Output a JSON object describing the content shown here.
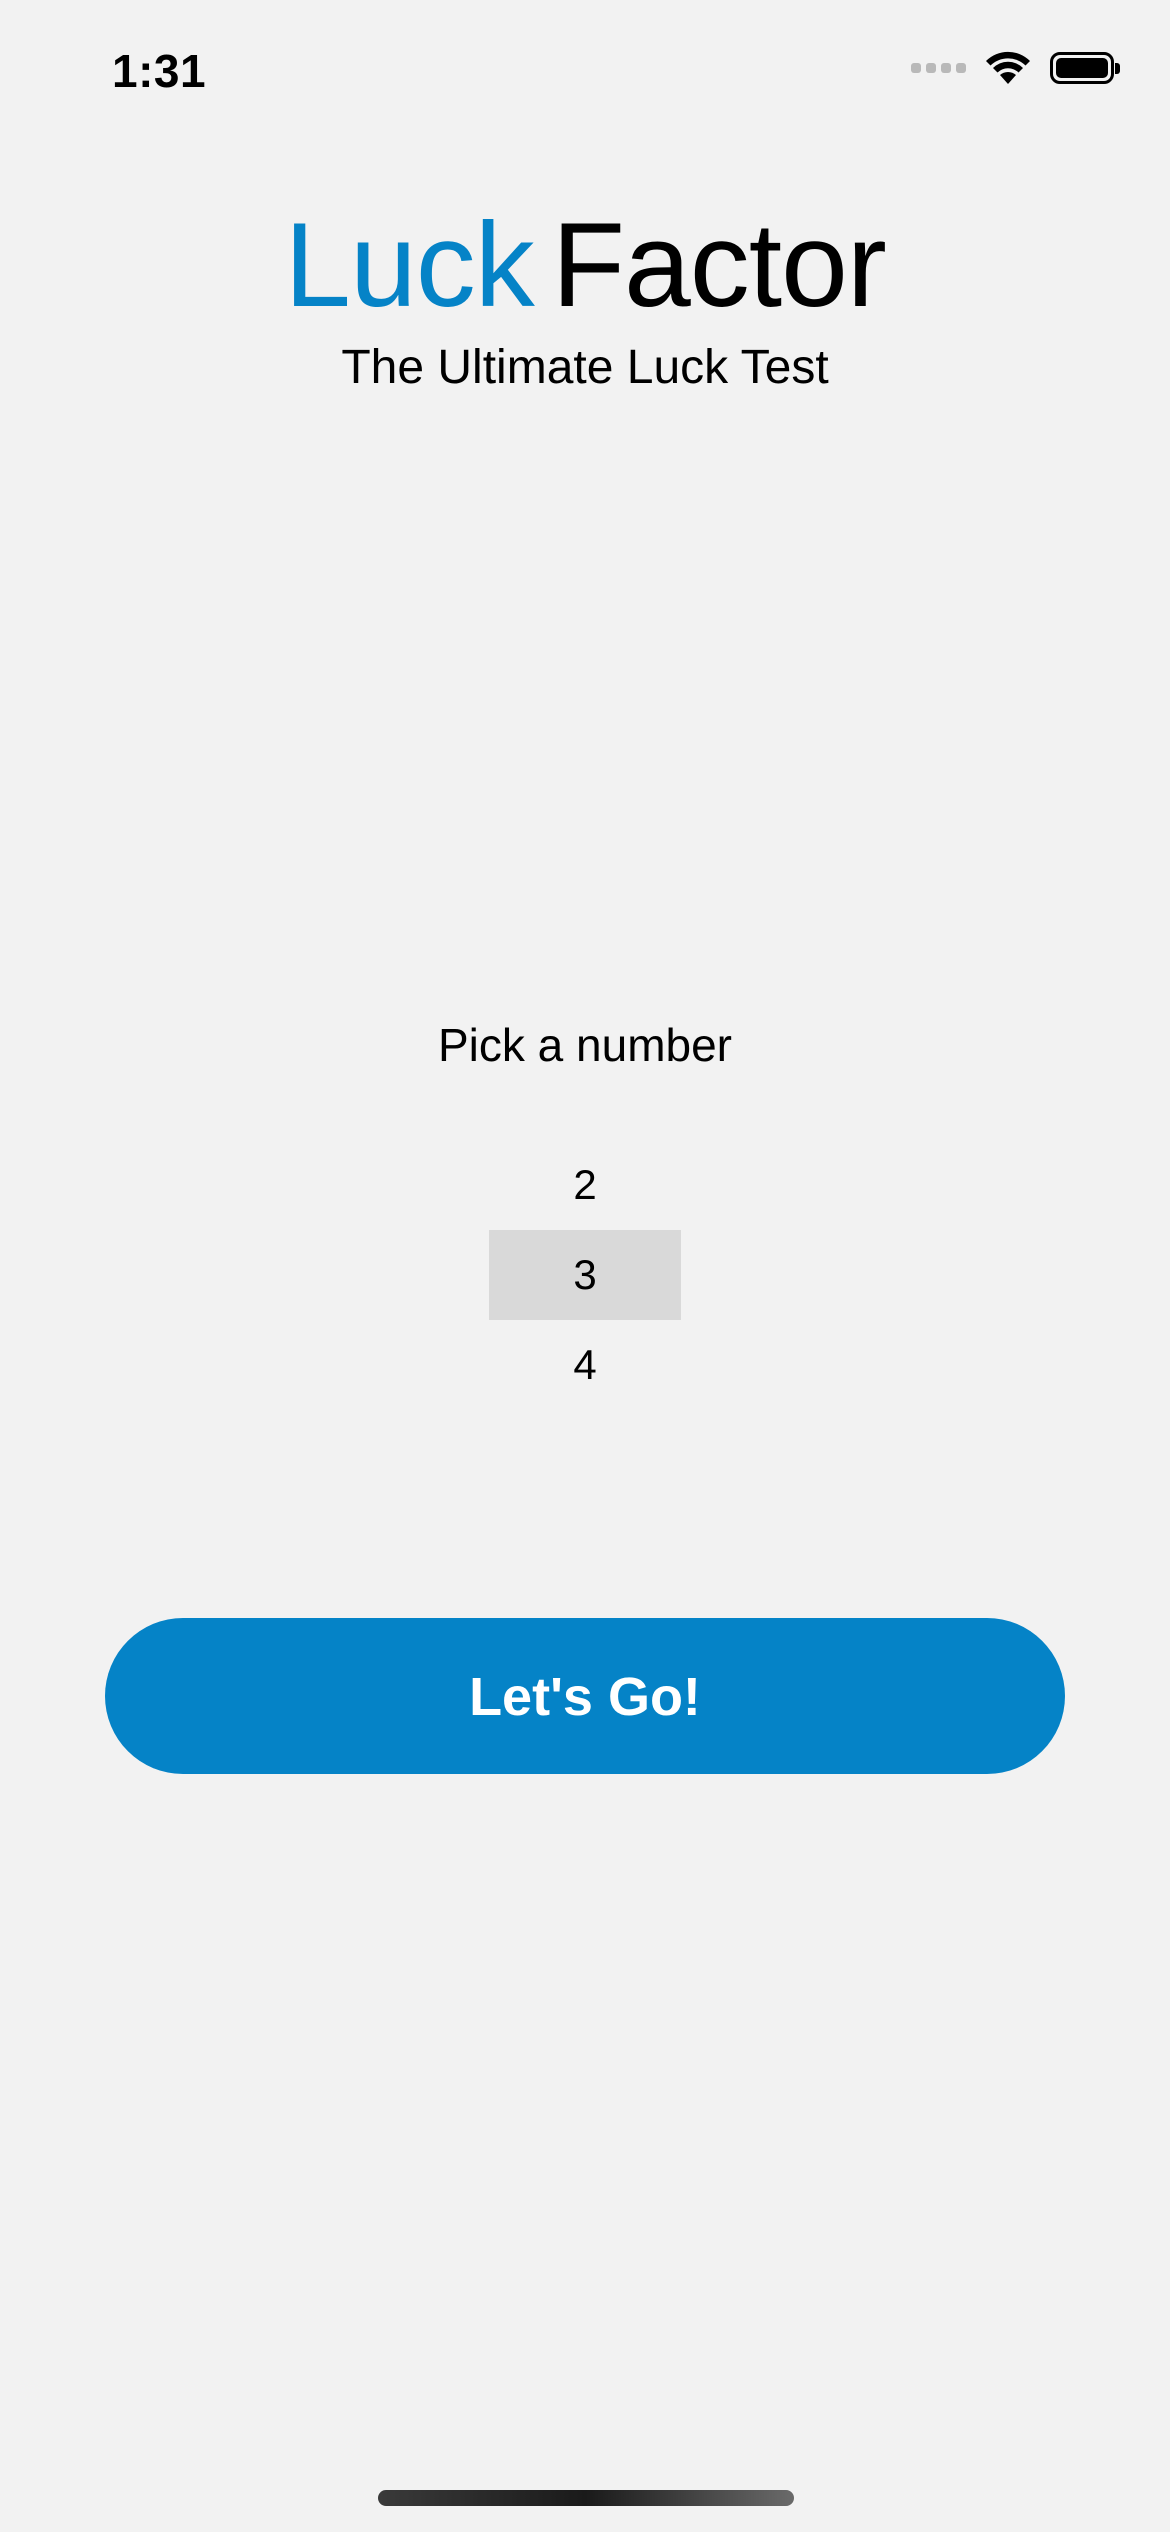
{
  "status_bar": {
    "time": "1:31",
    "icons": [
      "cellular-signal-icon",
      "wifi-icon",
      "battery-icon"
    ]
  },
  "header": {
    "title_part1": "Luck",
    "title_part2": "Factor",
    "subtitle": "The Ultimate Luck Test"
  },
  "picker": {
    "label": "Pick a number",
    "visible_options": [
      "2",
      "3",
      "4"
    ],
    "selected_value": "3"
  },
  "action": {
    "button_label": "Let's Go!"
  },
  "colors": {
    "accent": "#0583c7",
    "background": "#f2f2f2",
    "picker_selection": "#d9d9d9",
    "text": "#000000"
  }
}
